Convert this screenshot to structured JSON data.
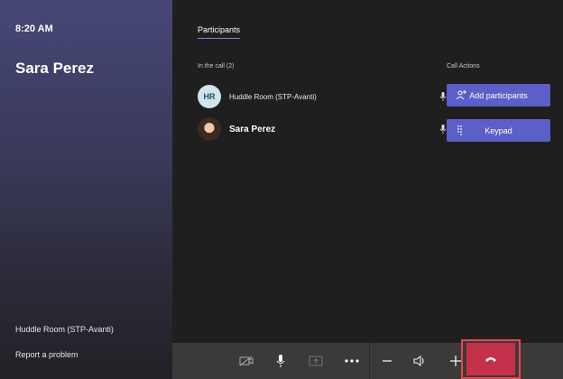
{
  "sidebar": {
    "time": "8:20 AM",
    "callee_name": "Sara Perez",
    "room_name": "Huddle Room (STP-Avanti)",
    "report_link": "Report a problem"
  },
  "main": {
    "tab_label": "Participants",
    "in_call_label": "In the call (2)",
    "call_actions_label": "Call Actions",
    "participants": [
      {
        "initials": "HR",
        "name": "Huddle Room (STP-Avanti)"
      },
      {
        "name": "Sara Perez"
      }
    ],
    "actions": {
      "add_participants": "Add participants",
      "keypad": "Keypad"
    }
  },
  "colors": {
    "accent": "#5b5fc7",
    "hangup": "#c4314b",
    "highlight": "#e8474e"
  },
  "icons": [
    "video-off-icon",
    "mic-icon",
    "share-screen-icon",
    "more-icon",
    "volume-down-icon",
    "speaker-icon",
    "volume-up-icon",
    "hang-up-icon",
    "add-person-icon",
    "keypad-icon"
  ]
}
